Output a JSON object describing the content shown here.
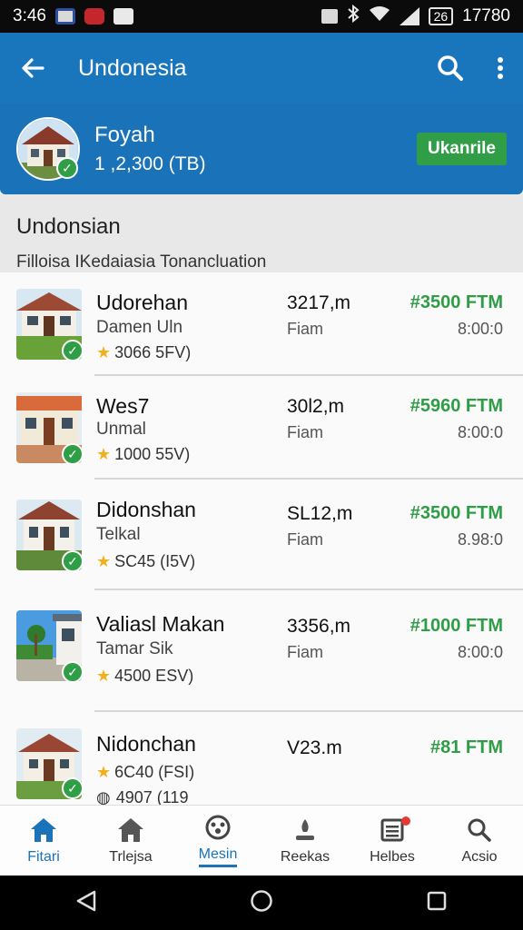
{
  "status_bar": {
    "time": "3:46",
    "right_text": "17780",
    "battery": "26"
  },
  "app_bar": {
    "title": "Undonesia",
    "back_icon": "arrow-left-icon",
    "search_icon": "search-icon",
    "more_icon": "more-vert-icon"
  },
  "profile": {
    "name": "Foyah",
    "subtitle": "1 ,2,300 (TB)",
    "button_label": "Ukanrile"
  },
  "section": {
    "title": "Undonsian",
    "subtitle": "Filloisa IKedaiasia Tonancluation"
  },
  "rows": [
    {
      "name": "Udorehan",
      "sub": "Damen Uln",
      "rating": "3066 5FV)",
      "dist": "3217,m",
      "dist_sub": "Fiam",
      "price": "#3500 FTM",
      "time": "8:00:0"
    },
    {
      "name": "Wes7",
      "sub": "Unmal",
      "rating": "1000 55V)",
      "dist": "30l2,m",
      "dist_sub": "Fiam",
      "price": "#5960 FTM",
      "time": "8:00:0"
    },
    {
      "name": "Didonshan",
      "sub": "Telkal",
      "rating": "SC45 (I5V)",
      "dist": "SL12,m",
      "dist_sub": "Fiam",
      "price": "#3500 FTM",
      "time": "8.98:0"
    },
    {
      "name": "Valiasl Makan",
      "sub": "Tamar Sik",
      "rating": "4500 ESV)",
      "dist": "3356,m",
      "dist_sub": "Fiam",
      "price": "#1000 FTM",
      "time": "8:00:0"
    },
    {
      "name": "Nidonchan",
      "sub": "",
      "rating": "6C40 (FSI)",
      "rating2": "4907 (119",
      "dist": "V23.m",
      "dist_sub": "",
      "price": "#81 FTM",
      "time": ""
    }
  ],
  "bottom_nav": [
    {
      "label": "Fitari",
      "icon": "home-icon"
    },
    {
      "label": "Trlejsa",
      "icon": "home-outline-icon"
    },
    {
      "label": "Mesin",
      "icon": "dashboard-icon"
    },
    {
      "label": "Reekas",
      "icon": "person-icon"
    },
    {
      "label": "Helbes",
      "icon": "list-icon"
    },
    {
      "label": "Acsio",
      "icon": "search-icon"
    }
  ],
  "colors": {
    "primary": "#1976bd",
    "accent_green": "#2e9d46",
    "badge_red": "#e53935"
  }
}
